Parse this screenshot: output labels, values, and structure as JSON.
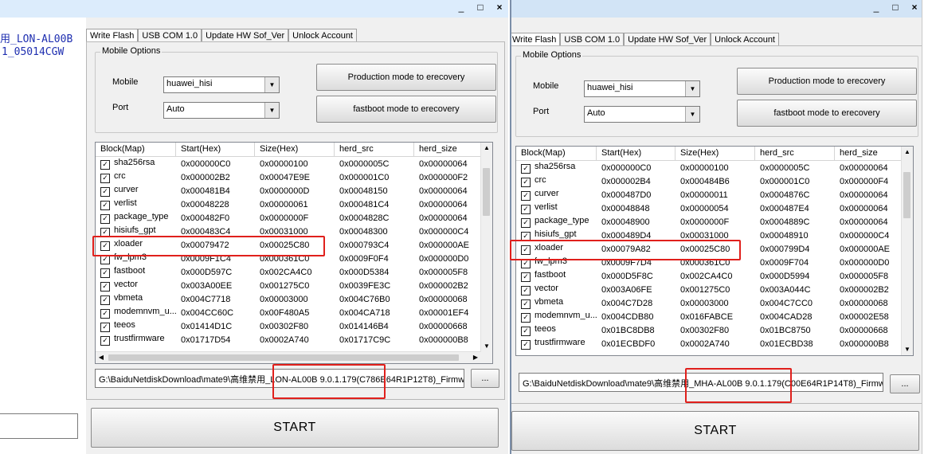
{
  "background_window": {
    "line1": "用_LON-AL00B",
    "line2": "1_05014CGW"
  },
  "window_controls": {
    "minimize": "_",
    "maximize": "□",
    "close": "×"
  },
  "columns": [
    "Block(Map)",
    "Start(Hex)",
    "Size(Hex)",
    "herd_src",
    "herd_size"
  ],
  "tool_left": {
    "tabs": [
      "Write Flash",
      "USB COM 1.0",
      "Update HW Sof_Ver",
      "Unlock Account"
    ],
    "group_title": "Mobile Options",
    "mobile_label": "Mobile",
    "mobile_value": "huawei_hisi",
    "port_label": "Port",
    "port_value": "Auto",
    "btn_production": "Production mode to erecovery",
    "btn_fastboot": "fastboot mode to erecovery",
    "rows": [
      {
        "block": "sha256rsa",
        "start": "0x000000C0",
        "size": "0x00000100",
        "src": "0x0000005C",
        "hsize": "0x00000064"
      },
      {
        "block": "crc",
        "start": "0x000002B2",
        "size": "0x00047E9E",
        "src": "0x000001C0",
        "hsize": "0x000000F2"
      },
      {
        "block": "curver",
        "start": "0x000481B4",
        "size": "0x0000000D",
        "src": "0x00048150",
        "hsize": "0x00000064"
      },
      {
        "block": "verlist",
        "start": "0x00048228",
        "size": "0x00000061",
        "src": "0x000481C4",
        "hsize": "0x00000064"
      },
      {
        "block": "package_type",
        "start": "0x000482F0",
        "size": "0x0000000F",
        "src": "0x0004828C",
        "hsize": "0x00000064"
      },
      {
        "block": "hisiufs_gpt",
        "start": "0x000483C4",
        "size": "0x00031000",
        "src": "0x00048300",
        "hsize": "0x000000C4"
      },
      {
        "block": "xloader",
        "start": "0x00079472",
        "size": "0x00025C80",
        "src": "0x000793C4",
        "hsize": "0x000000AE"
      },
      {
        "block": "fw_lpm3",
        "start": "0x0009F1C4",
        "size": "0x000361C0",
        "src": "0x0009F0F4",
        "hsize": "0x000000D0"
      },
      {
        "block": "fastboot",
        "start": "0x000D597C",
        "size": "0x002CA4C0",
        "src": "0x000D5384",
        "hsize": "0x000005F8"
      },
      {
        "block": "vector",
        "start": "0x003A00EE",
        "size": "0x001275C0",
        "src": "0x0039FE3C",
        "hsize": "0x000002B2"
      },
      {
        "block": "vbmeta",
        "start": "0x004C7718",
        "size": "0x00003000",
        "src": "0x004C76B0",
        "hsize": "0x00000068"
      },
      {
        "block": "modemnvm_u...",
        "start": "0x004CC60C",
        "size": "0x00F480A5",
        "src": "0x004CA718",
        "hsize": "0x00001EF4"
      },
      {
        "block": "teeos",
        "start": "0x01414D1C",
        "size": "0x00302F80",
        "src": "0x014146B4",
        "hsize": "0x00000668"
      },
      {
        "block": "trustfirmware",
        "start": "0x01717D54",
        "size": "0x0002A740",
        "src": "0x01717C9C",
        "hsize": "0x000000B8"
      }
    ],
    "path": "G:\\BaiduNetdiskDownload\\mate9\\高维禁用_LON-AL00B 9.0.1.179(C786E64R1P12T8)_Firmw",
    "browse": "...",
    "start": "START"
  },
  "tool_right": {
    "tabs": [
      "Write Flash",
      "USB COM 1.0",
      "Update HW Sof_Ver",
      "Unlock Account"
    ],
    "group_title": "Mobile Options",
    "mobile_label": "Mobile",
    "mobile_value": "huawei_hisi",
    "port_label": "Port",
    "port_value": "Auto",
    "btn_production": "Production mode to erecovery",
    "btn_fastboot": "fastboot mode to erecovery",
    "rows": [
      {
        "block": "sha256rsa",
        "start": "0x000000C0",
        "size": "0x00000100",
        "src": "0x0000005C",
        "hsize": "0x00000064"
      },
      {
        "block": "crc",
        "start": "0x000002B4",
        "size": "0x000484B6",
        "src": "0x000001C0",
        "hsize": "0x000000F4"
      },
      {
        "block": "curver",
        "start": "0x000487D0",
        "size": "0x00000011",
        "src": "0x0004876C",
        "hsize": "0x00000064"
      },
      {
        "block": "verlist",
        "start": "0x00048848",
        "size": "0x00000054",
        "src": "0x000487E4",
        "hsize": "0x00000064"
      },
      {
        "block": "package_type",
        "start": "0x00048900",
        "size": "0x0000000F",
        "src": "0x0004889C",
        "hsize": "0x00000064"
      },
      {
        "block": "hisiufs_gpt",
        "start": "0x000489D4",
        "size": "0x00031000",
        "src": "0x00048910",
        "hsize": "0x000000C4"
      },
      {
        "block": "xloader",
        "start": "0x00079A82",
        "size": "0x00025C80",
        "src": "0x000799D4",
        "hsize": "0x000000AE"
      },
      {
        "block": "fw_lpm3",
        "start": "0x0009F7D4",
        "size": "0x000361C0",
        "src": "0x0009F704",
        "hsize": "0x000000D0"
      },
      {
        "block": "fastboot",
        "start": "0x000D5F8C",
        "size": "0x002CA4C0",
        "src": "0x000D5994",
        "hsize": "0x000005F8"
      },
      {
        "block": "vector",
        "start": "0x003A06FE",
        "size": "0x001275C0",
        "src": "0x003A044C",
        "hsize": "0x000002B2"
      },
      {
        "block": "vbmeta",
        "start": "0x004C7D28",
        "size": "0x00003000",
        "src": "0x004C7CC0",
        "hsize": "0x00000068"
      },
      {
        "block": "modemnvm_u...",
        "start": "0x004CDB80",
        "size": "0x016FABCE",
        "src": "0x004CAD28",
        "hsize": "0x00002E58"
      },
      {
        "block": "teeos",
        "start": "0x01BC8DB8",
        "size": "0x00302F80",
        "src": "0x01BC8750",
        "hsize": "0x00000668"
      },
      {
        "block": "trustfirmware",
        "start": "0x01ECBDF0",
        "size": "0x0002A740",
        "src": "0x01ECBD38",
        "hsize": "0x000000B8"
      }
    ],
    "path": "G:\\BaiduNetdiskDownload\\mate9\\高维禁用_MHA-AL00B 9.0.1.179(C00E64R1P14T8)_Firmw",
    "browse": "...",
    "start": "START"
  },
  "colors": {
    "highlight": "#e0201c",
    "titlebar": "#dcecfc"
  }
}
